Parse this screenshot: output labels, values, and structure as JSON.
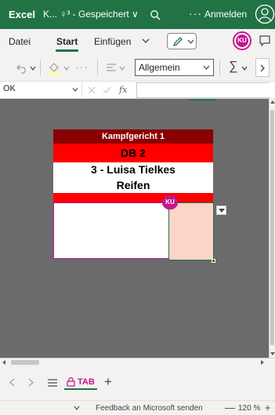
{
  "titlebar": {
    "app_name": "Excel",
    "doc_title": "K... ♀³ - Gespeichert ∨",
    "more": "···",
    "signin": "Anmelden"
  },
  "ribbon": {
    "tabs": [
      "Datei",
      "Start",
      "Einfügen"
    ],
    "active_tab": "Start",
    "user_initials": "KU"
  },
  "toolbar": {
    "number_format": "Allgemein"
  },
  "formula_bar": {
    "name_box": "OK",
    "fx_label": "fx",
    "formula": ""
  },
  "sheet": {
    "rows": [
      "Kampfgericht 1",
      "DB 2",
      "3 - Luisa Tielkes",
      "Reifen"
    ],
    "collaborator_badge": "KU",
    "colors": {
      "header_dark_red": "#8b0000",
      "header_red": "#ff0000",
      "selected_cell_fill": "#fcd5c9",
      "collaborator": "#c4168d",
      "excel_green": "#217346"
    }
  },
  "sheet_tabs": {
    "tabs": [
      {
        "label": "TAB",
        "icon": "lock-icon",
        "active": true
      }
    ]
  },
  "statusbar": {
    "feedback": "Feedback an Microsoft senden",
    "zoom_out": "—",
    "zoom": "120 %",
    "zoom_in": "+"
  }
}
